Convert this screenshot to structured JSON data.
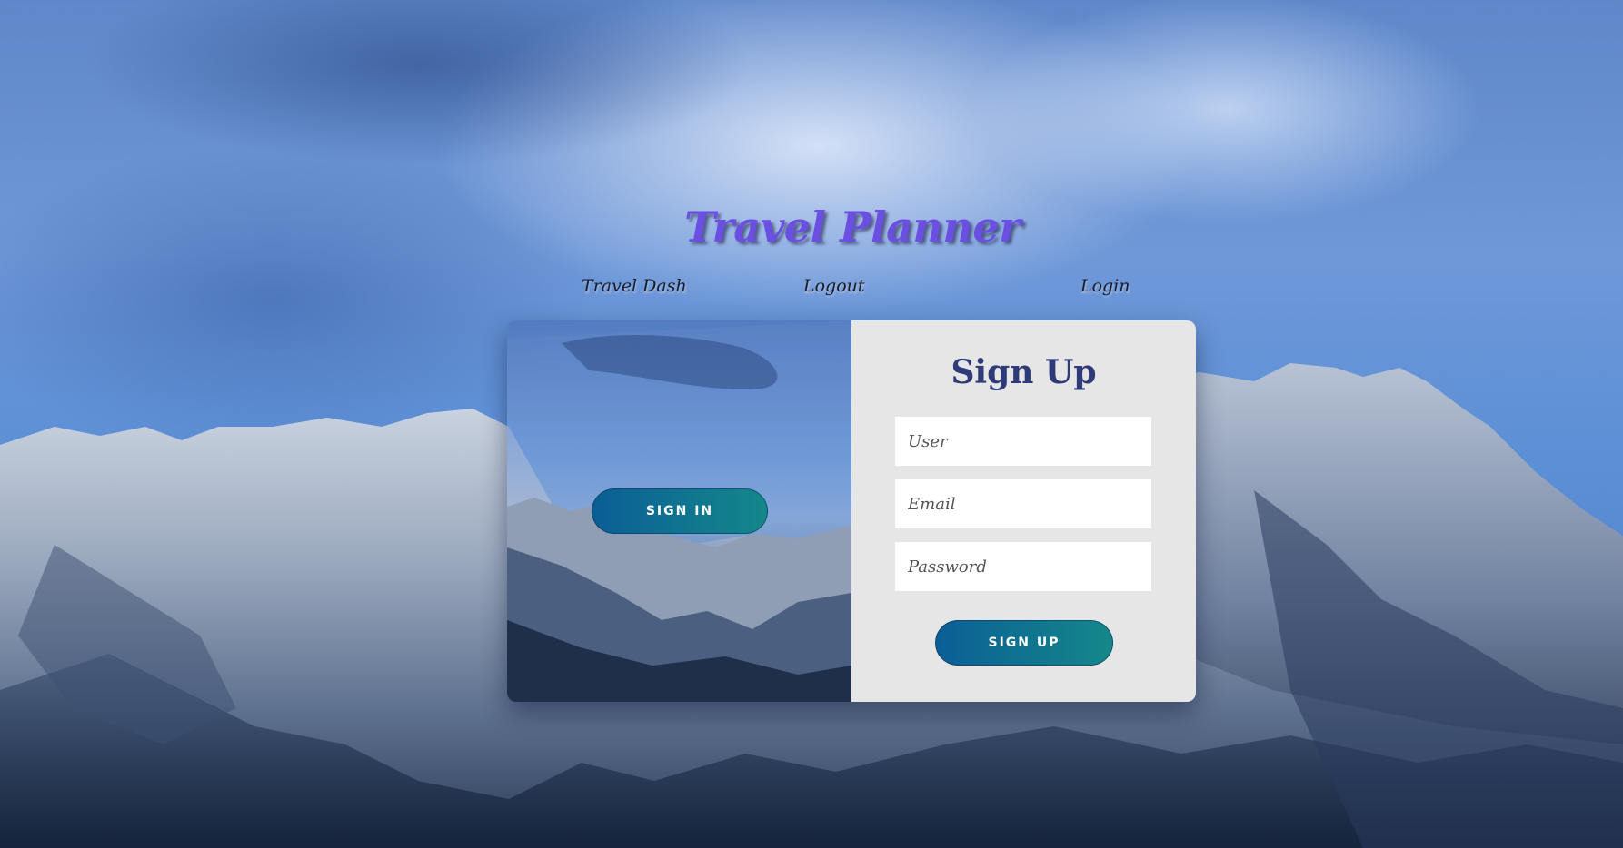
{
  "header": {
    "title": "Travel Planner"
  },
  "nav": {
    "items": [
      {
        "label": "Travel Dash"
      },
      {
        "label": "Logout"
      },
      {
        "label": "Login"
      }
    ]
  },
  "overlay_panel": {
    "button_label": "SIGN IN"
  },
  "signup_form": {
    "title": "Sign Up",
    "user_placeholder": "User",
    "email_placeholder": "Email",
    "password_placeholder": "Password",
    "submit_label": "SIGN UP"
  },
  "colors": {
    "title": "#6a4fe0",
    "form_title": "#2f3a78",
    "button_start": "#0b5e95",
    "button_end": "#14888a",
    "form_background": "#e6e6e6"
  }
}
